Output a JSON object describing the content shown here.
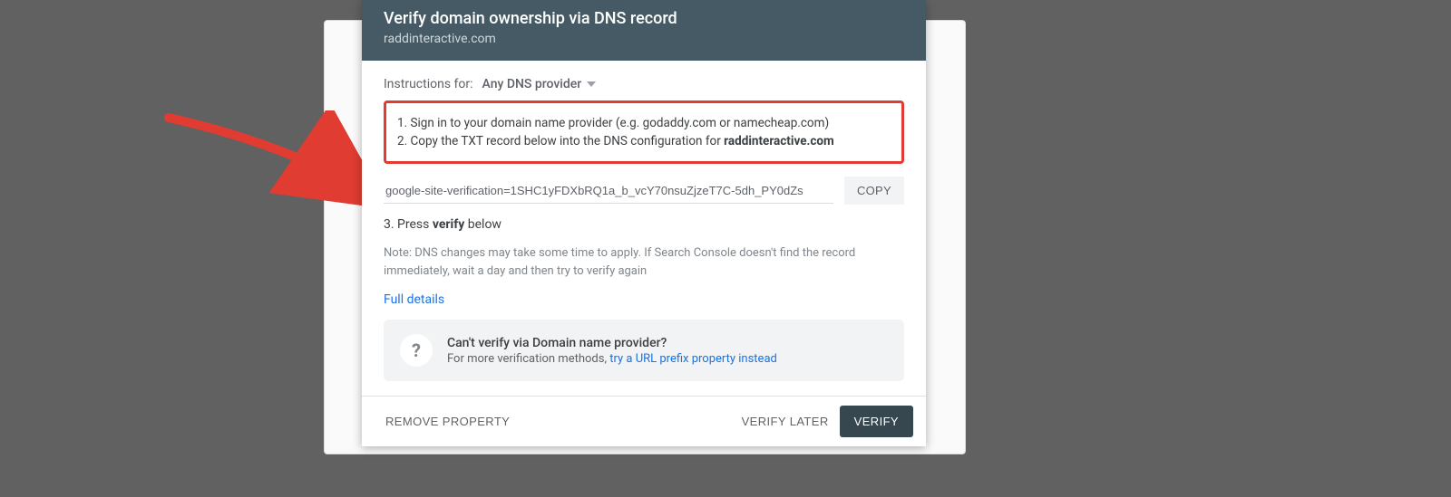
{
  "header": {
    "title": "Verify domain ownership via DNS record",
    "domain": "raddinteractive.com"
  },
  "instructions": {
    "label": "Instructions for:",
    "provider": "Any DNS provider",
    "step1": "1. Sign in to your domain name provider (e.g. godaddy.com or namecheap.com)",
    "step2_prefix": "2. Copy the TXT record below into the DNS configuration for ",
    "step2_domain": "raddinteractive.com"
  },
  "txt_record": "google-site-verification=1SHC1yFDXbRQ1a_b_vcY70nsuZjzeT7C-5dh_PY0dZs",
  "copy_label": "COPY",
  "press_verify_prefix": "3. Press ",
  "press_verify_bold": "verify",
  "press_verify_suffix": " below",
  "note": "Note: DNS changes may take some time to apply. If Search Console doesn't find the record immediately, wait a day and then try to verify again",
  "full_details": "Full details",
  "info": {
    "title": "Can't verify via Domain name provider?",
    "sub_prefix": "For more verification methods, ",
    "sub_link": "try a URL prefix property instead"
  },
  "actions": {
    "remove": "REMOVE PROPERTY",
    "later": "VERIFY LATER",
    "verify": "VERIFY"
  }
}
